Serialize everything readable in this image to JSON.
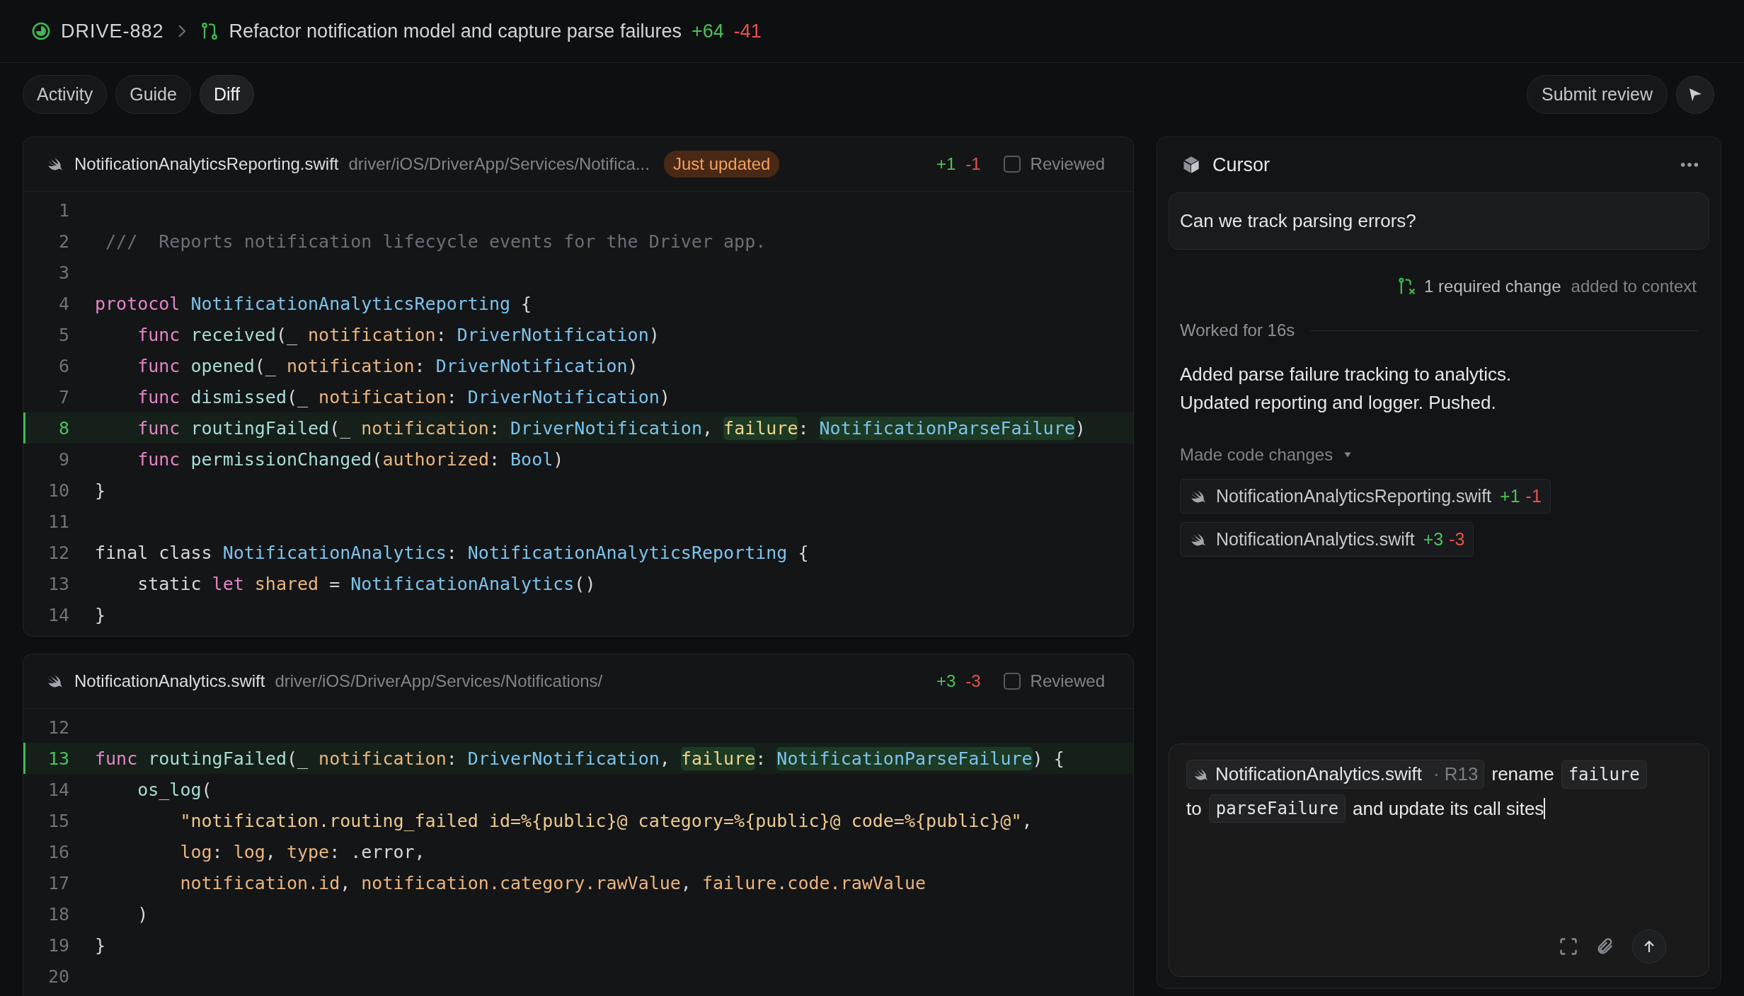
{
  "header": {
    "ticket": "DRIVE-882",
    "title": "Refactor notification model and capture parse failures",
    "additions": "+64",
    "deletions": "-41"
  },
  "tabs": [
    {
      "label": "Activity",
      "selected": false
    },
    {
      "label": "Guide",
      "selected": false
    },
    {
      "label": "Diff",
      "selected": true
    }
  ],
  "submit_button": "Submit review",
  "files": [
    {
      "name": "NotificationAnalyticsReporting.swift",
      "path": "driver/iOS/DriverApp/Services/Notifica...",
      "badge": "Just updated",
      "additions": "+1",
      "deletions": "-1",
      "reviewed": false,
      "reviewed_label": "Reviewed",
      "lines": [
        {
          "n": "1",
          "added": false
        },
        {
          "n": "2",
          "added": false,
          "tokens": [
            {
              "text": " ///  Reports notification lifecycle events for the Driver app.",
              "kind": "comment"
            }
          ]
        },
        {
          "n": "3",
          "added": false
        },
        {
          "n": "4",
          "added": false,
          "tokens": [
            {
              "text": "protocol",
              "kind": "keyword"
            },
            {
              "text": " NotificationAnalyticsReporting",
              "kind": "type"
            },
            {
              "text": " {",
              "kind": "plain"
            }
          ]
        },
        {
          "n": "5",
          "added": false,
          "tokens": [
            {
              "text": "    func",
              "kind": "keyword"
            },
            {
              "text": " received",
              "kind": "function"
            },
            {
              "text": "(_ ",
              "kind": "plain"
            },
            {
              "text": "notification",
              "kind": "param"
            },
            {
              "text": ": ",
              "kind": "plain"
            },
            {
              "text": "DriverNotification",
              "kind": "type"
            },
            {
              "text": ")",
              "kind": "plain"
            }
          ]
        },
        {
          "n": "6",
          "added": false,
          "tokens": [
            {
              "text": "    func",
              "kind": "keyword"
            },
            {
              "text": " opened",
              "kind": "function"
            },
            {
              "text": "(_ ",
              "kind": "plain"
            },
            {
              "text": "notification",
              "kind": "param"
            },
            {
              "text": ": ",
              "kind": "plain"
            },
            {
              "text": "DriverNotification",
              "kind": "type"
            },
            {
              "text": ")",
              "kind": "plain"
            }
          ]
        },
        {
          "n": "7",
          "added": false,
          "tokens": [
            {
              "text": "    func",
              "kind": "keyword"
            },
            {
              "text": " dismissed",
              "kind": "function"
            },
            {
              "text": "(_ ",
              "kind": "plain"
            },
            {
              "text": "notification",
              "kind": "param"
            },
            {
              "text": ": ",
              "kind": "plain"
            },
            {
              "text": "DriverNotification",
              "kind": "type"
            },
            {
              "text": ")",
              "kind": "plain"
            }
          ]
        },
        {
          "n": "8",
          "added": true,
          "tokens": [
            {
              "text": "    func",
              "kind": "keyword"
            },
            {
              "text": " routingFailed",
              "kind": "function"
            },
            {
              "text": "(_ ",
              "kind": "plain"
            },
            {
              "text": "notification",
              "kind": "param"
            },
            {
              "text": ": ",
              "kind": "plain"
            },
            {
              "text": "DriverNotification",
              "kind": "type"
            },
            {
              "text": ", ",
              "kind": "plain"
            },
            {
              "text": "failure",
              "kind": "new-param"
            },
            {
              "text": ": ",
              "kind": "plain"
            },
            {
              "text": "NotificationParseFailure",
              "kind": "new-type"
            },
            {
              "text": ")",
              "kind": "plain"
            }
          ]
        },
        {
          "n": "9",
          "added": false,
          "tokens": [
            {
              "text": "    func",
              "kind": "keyword"
            },
            {
              "text": " permissionChanged",
              "kind": "function"
            },
            {
              "text": "(",
              "kind": "plain"
            },
            {
              "text": "authorized",
              "kind": "param"
            },
            {
              "text": ": ",
              "kind": "plain"
            },
            {
              "text": "Bool",
              "kind": "type"
            },
            {
              "text": ")",
              "kind": "plain"
            }
          ]
        },
        {
          "n": "10",
          "added": false,
          "tokens": [
            {
              "text": "}",
              "kind": "plain"
            }
          ]
        },
        {
          "n": "11",
          "added": false
        },
        {
          "n": "12",
          "added": false,
          "tokens": [
            {
              "text": "final class ",
              "kind": "plain"
            },
            {
              "text": "NotificationAnalytics",
              "kind": "type"
            },
            {
              "text": ": ",
              "kind": "plain"
            },
            {
              "text": "NotificationAnalyticsReporting",
              "kind": "type"
            },
            {
              "text": " {",
              "kind": "plain"
            }
          ]
        },
        {
          "n": "13",
          "added": false,
          "tokens": [
            {
              "text": "    static ",
              "kind": "plain"
            },
            {
              "text": "let",
              "kind": "keyword"
            },
            {
              "text": " shared",
              "kind": "param"
            },
            {
              "text": " = ",
              "kind": "plain"
            },
            {
              "text": "NotificationAnalytics",
              "kind": "type"
            },
            {
              "text": "()",
              "kind": "plain"
            }
          ]
        },
        {
          "n": "14",
          "added": false,
          "tokens": [
            {
              "text": "}",
              "kind": "plain"
            }
          ]
        }
      ]
    },
    {
      "name": "NotificationAnalytics.swift",
      "path": "driver/iOS/DriverApp/Services/Notifications/",
      "additions": "+3",
      "deletions": "-3",
      "reviewed": false,
      "reviewed_label": "Reviewed",
      "lines": [
        {
          "n": "12",
          "added": false
        },
        {
          "n": "13",
          "added": true,
          "tokens": [
            {
              "text": "func",
              "kind": "keyword"
            },
            {
              "text": " routingFailed",
              "kind": "function"
            },
            {
              "text": "(_ ",
              "kind": "plain"
            },
            {
              "text": "notification",
              "kind": "param"
            },
            {
              "text": ": ",
              "kind": "plain"
            },
            {
              "text": "DriverNotification",
              "kind": "type"
            },
            {
              "text": ", ",
              "kind": "plain"
            },
            {
              "text": "failure",
              "kind": "new-param"
            },
            {
              "text": ": ",
              "kind": "plain"
            },
            {
              "text": "NotificationParseFailure",
              "kind": "new-type"
            },
            {
              "text": ") {",
              "kind": "plain"
            }
          ]
        },
        {
          "n": "14",
          "added": false,
          "tokens": [
            {
              "text": "    os_log",
              "kind": "function"
            },
            {
              "text": "(",
              "kind": "plain"
            }
          ]
        },
        {
          "n": "15",
          "added": false,
          "tokens": [
            {
              "text": "        \"notification.routing_failed id=%{public}@ category=%{public}@ code=%{public}@\"",
              "kind": "string"
            },
            {
              "text": ",",
              "kind": "plain"
            }
          ]
        },
        {
          "n": "16",
          "added": false,
          "tokens": [
            {
              "text": "        log",
              "kind": "param"
            },
            {
              "text": ": ",
              "kind": "plain"
            },
            {
              "text": "log",
              "kind": "param"
            },
            {
              "text": ", ",
              "kind": "plain"
            },
            {
              "text": "type",
              "kind": "param"
            },
            {
              "text": ": .error,",
              "kind": "plain"
            }
          ]
        },
        {
          "n": "17",
          "added": false,
          "tokens": [
            {
              "text": "        notification.id",
              "kind": "param"
            },
            {
              "text": ", ",
              "kind": "plain"
            },
            {
              "text": "notification.category.rawValue",
              "kind": "param"
            },
            {
              "text": ", ",
              "kind": "plain"
            },
            {
              "text": "failure.code.rawValue",
              "kind": "param"
            }
          ]
        },
        {
          "n": "18",
          "added": false,
          "tokens": [
            {
              "text": "    )",
              "kind": "plain"
            }
          ]
        },
        {
          "n": "19",
          "added": false,
          "tokens": [
            {
              "text": "}",
              "kind": "plain"
            }
          ]
        },
        {
          "n": "20",
          "added": false
        }
      ]
    }
  ],
  "assistant": {
    "name": "Cursor",
    "question": "Can we track parsing errors?",
    "context": "1 required change",
    "context_note": "added to context",
    "worked": "Worked for 16s",
    "message": [
      "Added parse failure tracking to analytics.",
      "Updated reporting and logger. Pushed."
    ],
    "changes_label": "Made code changes",
    "changes": [
      {
        "name": "NotificationAnalyticsReporting.swift",
        "additions": "+1",
        "deletions": "-1"
      },
      {
        "name": "NotificationAnalytics.swift",
        "additions": "+3",
        "deletions": "-3"
      }
    ],
    "composer": [
      {
        "kind": "file",
        "text": "NotificationAnalytics.swift",
        "ref": "· R13"
      },
      {
        "kind": "text",
        "text": "rename"
      },
      {
        "kind": "code",
        "text": "failure"
      },
      {
        "kind": "text",
        "text": "to"
      },
      {
        "kind": "code",
        "text": "parseFailure"
      },
      {
        "kind": "text",
        "text": "and update its call sites"
      },
      {
        "kind": "caret"
      }
    ]
  }
}
